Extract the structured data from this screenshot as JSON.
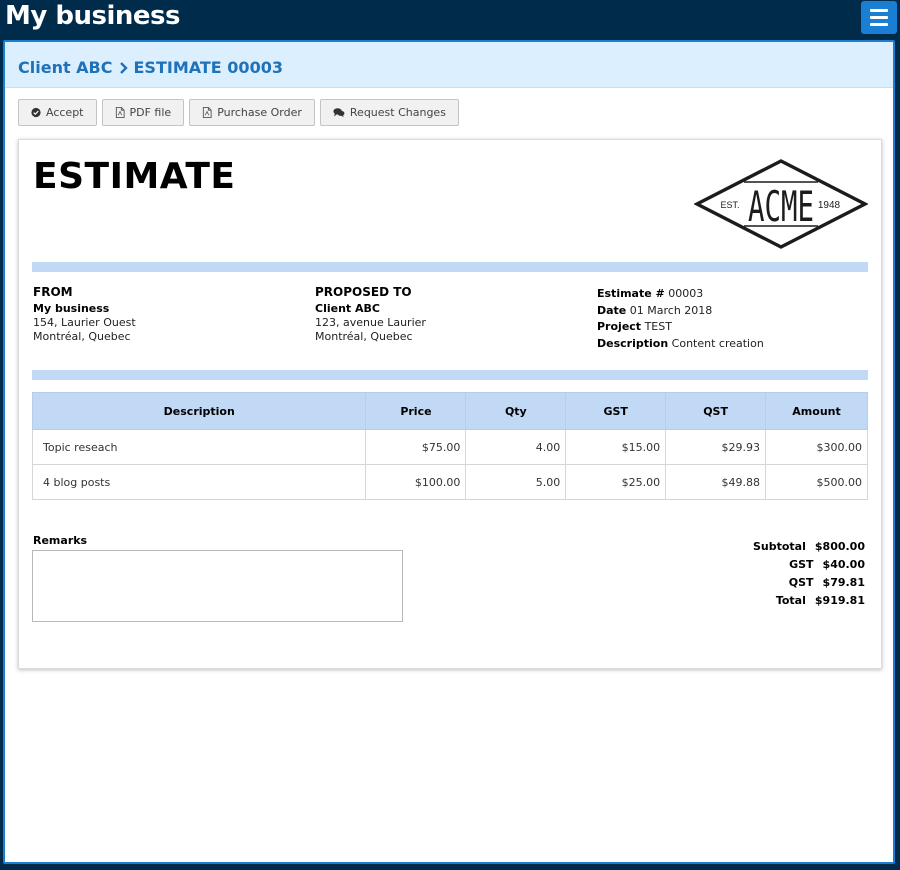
{
  "app": {
    "title": "My business",
    "menu_icon": "hamburger-menu-icon"
  },
  "breadcrumb": {
    "client": "Client ABC",
    "separator_icon": "chevron-right-icon",
    "document": "ESTIMATE 00003"
  },
  "toolbar": {
    "accept": {
      "label": "Accept",
      "icon": "check-circle-icon"
    },
    "pdf": {
      "label": "PDF file",
      "icon": "pdf-file-icon"
    },
    "purchase_order": {
      "label": "Purchase Order",
      "icon": "pdf-file-icon"
    },
    "request_changes": {
      "label": "Request Changes",
      "icon": "comments-icon"
    }
  },
  "document": {
    "heading": "ESTIMATE",
    "logo": {
      "icon": "acme-logo",
      "brand": "ACME",
      "est": "EST.",
      "year": "1948"
    },
    "from": {
      "title": "FROM",
      "name": "My business",
      "address1": "154, Laurier Ouest",
      "address2": "Montréal, Quebec"
    },
    "proposed_to": {
      "title": "PROPOSED TO",
      "name": "Client ABC",
      "address1": "123, avenue Laurier",
      "address2": "Montréal, Quebec"
    },
    "meta": {
      "estimate_label": "Estimate #",
      "estimate_value": "00003",
      "date_label": "Date",
      "date_value": "01 March 2018",
      "project_label": "Project",
      "project_value": "TEST",
      "description_label": "Description",
      "description_value": "Content creation"
    },
    "table": {
      "headers": {
        "description": "Description",
        "price": "Price",
        "qty": "Qty",
        "gst": "GST",
        "qst": "QST",
        "amount": "Amount"
      },
      "rows": [
        {
          "description": "Topic reseach",
          "price": "$75.00",
          "qty": "4.00",
          "gst": "$15.00",
          "qst": "$29.93",
          "amount": "$300.00"
        },
        {
          "description": "4 blog posts",
          "price": "$100.00",
          "qty": "5.00",
          "gst": "$25.00",
          "qst": "$49.88",
          "amount": "$500.00"
        }
      ]
    },
    "remarks": {
      "label": "Remarks",
      "value": ""
    },
    "totals": {
      "subtotal_label": "Subtotal",
      "subtotal_value": "$800.00",
      "gst_label": "GST",
      "gst_value": "$40.00",
      "qst_label": "QST",
      "qst_value": "$79.81",
      "total_label": "Total",
      "total_value": "$919.81"
    }
  },
  "colors": {
    "app_bg": "#002b4a",
    "accent": "#1a7ed3",
    "breadcrumb_bg": "#dcefff",
    "breadcrumb_text": "#1f72b8",
    "rule": "#c2d9f5"
  }
}
